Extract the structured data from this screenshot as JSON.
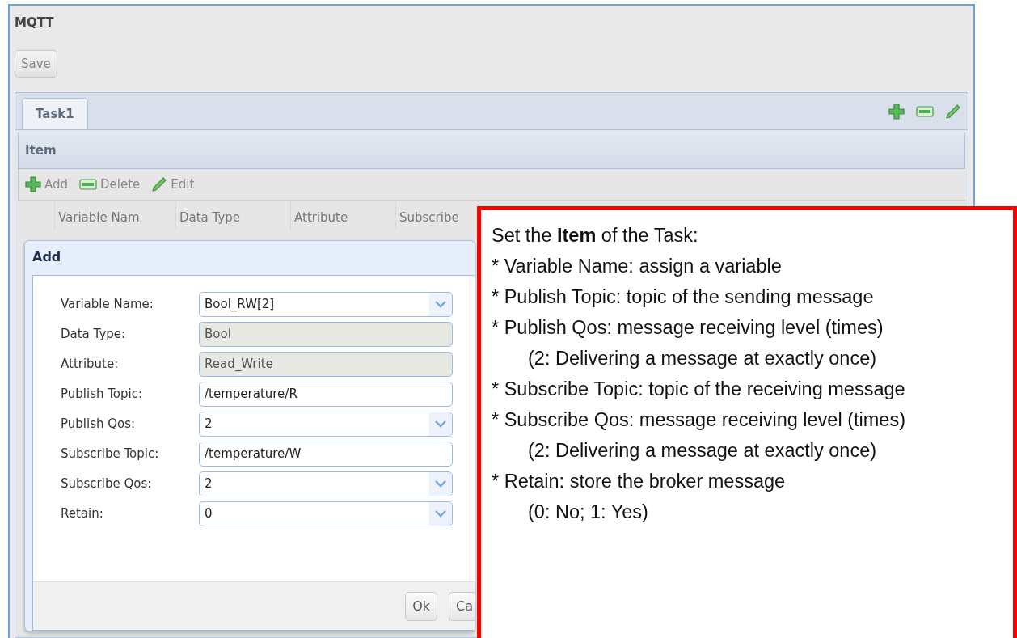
{
  "window": {
    "title": "MQTT"
  },
  "save_button": "Save",
  "tabs": [
    {
      "label": "Task1",
      "selected": true
    }
  ],
  "tab_tools": [
    {
      "kind": "add"
    },
    {
      "kind": "delete"
    },
    {
      "kind": "edit"
    }
  ],
  "panel": {
    "title": "Item"
  },
  "toolbar": [
    {
      "kind": "add",
      "label": "Add"
    },
    {
      "kind": "delete",
      "label": "Delete"
    },
    {
      "kind": "edit",
      "label": "Edit"
    }
  ],
  "table": {
    "columns": [
      "Variable Nam",
      "Data Type",
      "Attribute",
      "Subscribe"
    ]
  },
  "dialog": {
    "title": "Add",
    "fields": [
      {
        "label": "Variable Name:",
        "kind": "select",
        "value": "Bool_RW[2]"
      },
      {
        "label": "Data Type:",
        "kind": "readonly",
        "value": "Bool"
      },
      {
        "label": "Attribute:",
        "kind": "readonly",
        "value": "Read_Write"
      },
      {
        "label": "Publish Topic:",
        "kind": "text",
        "value": "/temperature/R"
      },
      {
        "label": "Publish Qos:",
        "kind": "select",
        "value": "2"
      },
      {
        "label": "Subscribe Topic:",
        "kind": "text",
        "value": "/temperature/W"
      },
      {
        "label": "Subscribe Qos:",
        "kind": "select",
        "value": "2"
      },
      {
        "label": "Retain:",
        "kind": "select",
        "value": "0"
      }
    ],
    "buttons": [
      "Ok",
      "Ca"
    ]
  },
  "callout": {
    "lines": [
      {
        "kind": "heading",
        "text": "Set the **Item** of the Task:"
      },
      {
        "kind": "bullet",
        "text": "* Variable Name: assign a variable"
      },
      {
        "kind": "bullet",
        "text": "* Publish Topic: topic of the sending message"
      },
      {
        "kind": "bullet",
        "text": "* Publish Qos: message receiving level (times)"
      },
      {
        "kind": "note",
        "text": "(2: Delivering a message at exactly once)"
      },
      {
        "kind": "bullet",
        "text": "* Subscribe Topic: topic of the receiving message"
      },
      {
        "kind": "bullet",
        "text": "* Subscribe Qos: message receiving level (times)"
      },
      {
        "kind": "note",
        "text": "(2: Delivering a message at exactly once)"
      },
      {
        "kind": "bullet",
        "text": "* Retain: store the broker message"
      },
      {
        "kind": "note",
        "text": "(0: No; 1: Yes)"
      }
    ]
  }
}
